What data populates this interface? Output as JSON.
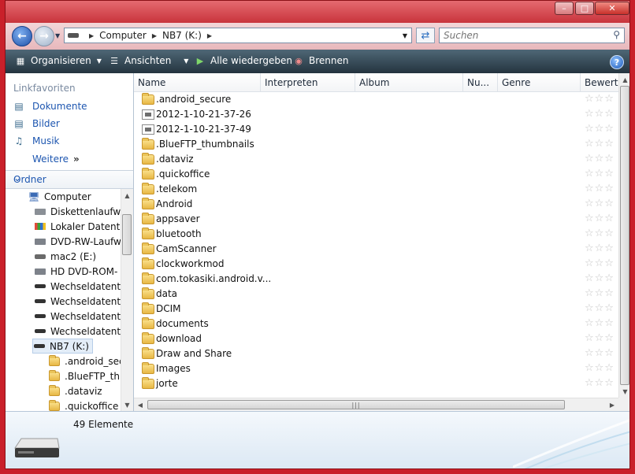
{
  "address": {
    "path": [
      "Computer",
      "NB7 (K:)"
    ]
  },
  "search": {
    "placeholder": "Suchen"
  },
  "toolbar": {
    "organize": "Organisieren",
    "views": "Ansichten",
    "play_all": "Alle wiedergeben",
    "burn": "Brennen"
  },
  "favorites": {
    "heading": "Linkfavoriten",
    "items": [
      "Dokumente",
      "Bilder",
      "Musik"
    ],
    "more": "Weitere"
  },
  "folders": {
    "heading": "Ordner",
    "tree": [
      "Computer",
      "Diskettenlaufw",
      "Lokaler Datent",
      "DVD-RW-Laufw",
      "mac2 (E:)",
      "HD DVD-ROM-",
      "Wechseldatent",
      "Wechseldatent",
      "Wechseldatent",
      "Wechseldatent",
      "NB7 (K:)",
      ".android_sec",
      ".BlueFTP_thu",
      ".dataviz",
      ".quickoffice"
    ]
  },
  "columns": [
    "Name",
    "Interpreten",
    "Album",
    "Nu...",
    "Genre",
    "Bewert"
  ],
  "files": [
    {
      "name": ".android_secure",
      "type": "folder"
    },
    {
      "name": "2012-1-10-21-37-26",
      "type": "image"
    },
    {
      "name": "2012-1-10-21-37-49",
      "type": "image"
    },
    {
      "name": ".BlueFTP_thumbnails",
      "type": "folder"
    },
    {
      "name": ".dataviz",
      "type": "folder"
    },
    {
      "name": ".quickoffice",
      "type": "folder"
    },
    {
      "name": ".telekom",
      "type": "folder"
    },
    {
      "name": "Android",
      "type": "folder"
    },
    {
      "name": "appsaver",
      "type": "folder"
    },
    {
      "name": "bluetooth",
      "type": "folder"
    },
    {
      "name": "CamScanner",
      "type": "folder"
    },
    {
      "name": "clockworkmod",
      "type": "folder"
    },
    {
      "name": "com.tokasiki.android.v...",
      "type": "folder"
    },
    {
      "name": "data",
      "type": "folder"
    },
    {
      "name": "DCIM",
      "type": "folder"
    },
    {
      "name": "documents",
      "type": "folder"
    },
    {
      "name": "download",
      "type": "folder"
    },
    {
      "name": "Draw and Share",
      "type": "folder"
    },
    {
      "name": "Images",
      "type": "folder"
    },
    {
      "name": "jorte",
      "type": "folder"
    }
  ],
  "status": {
    "count": "49 Elemente"
  }
}
